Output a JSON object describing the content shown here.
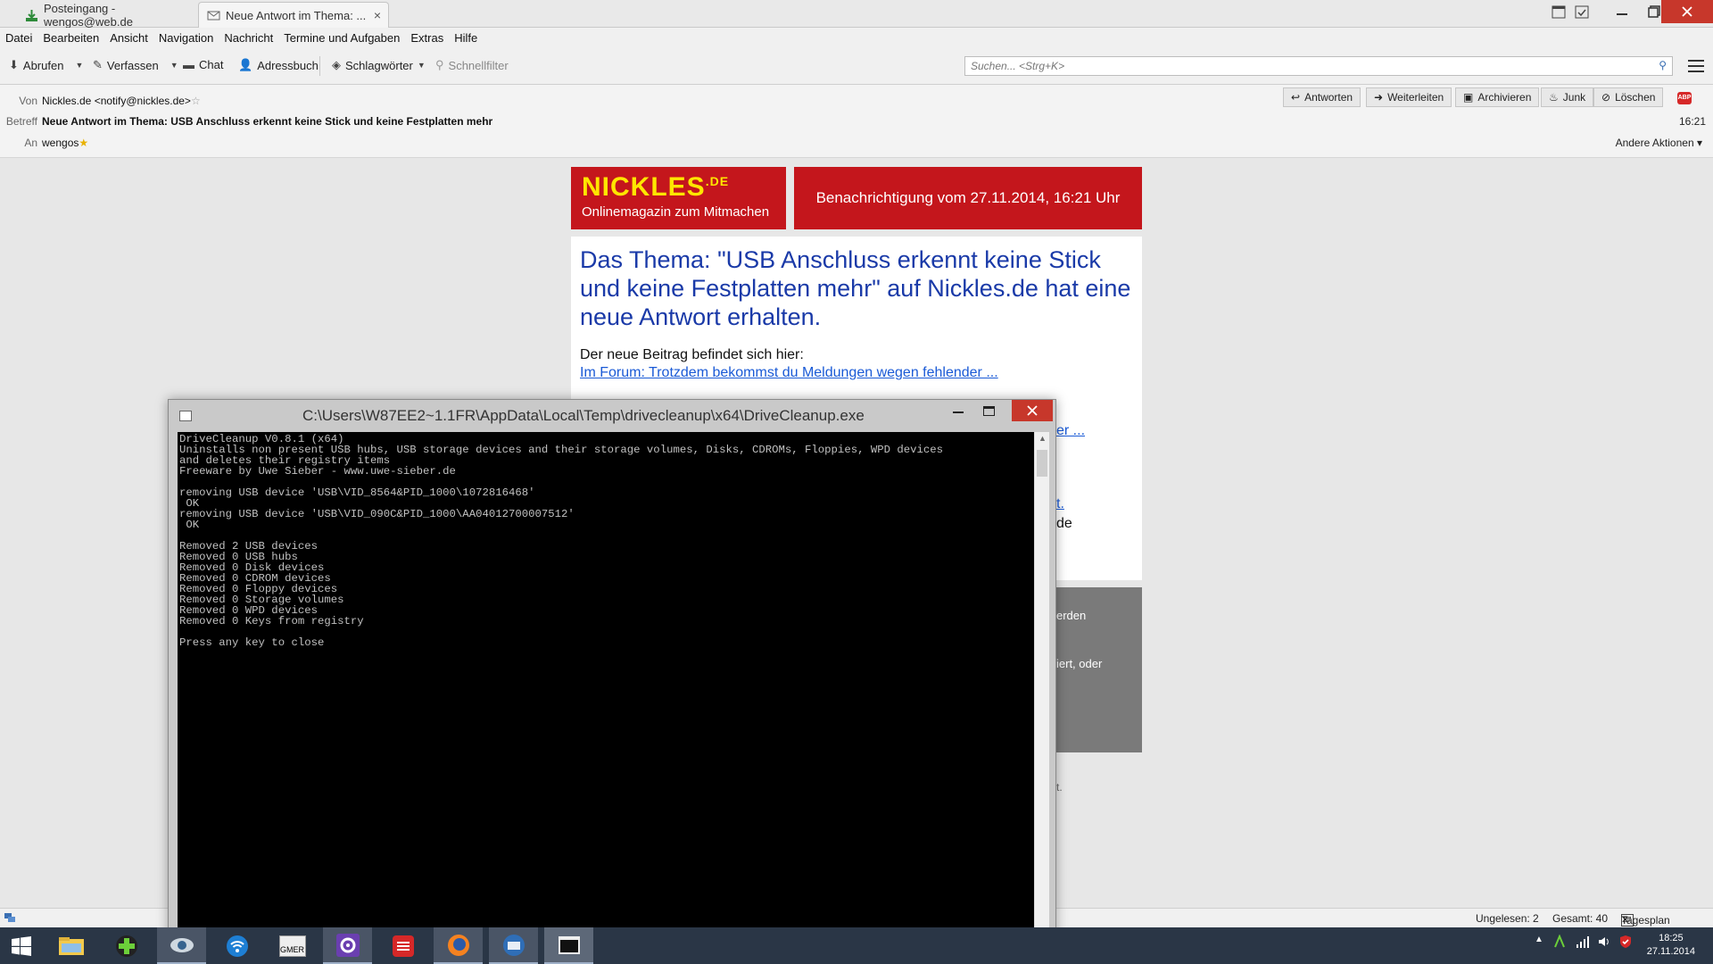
{
  "tabs": [
    {
      "label": "Posteingang - wengos@web.de"
    },
    {
      "label": "Neue Antwort im Thema: ...",
      "close": "×"
    }
  ],
  "menu": [
    "Datei",
    "Bearbeiten",
    "Ansicht",
    "Navigation",
    "Nachricht",
    "Termine und Aufgaben",
    "Extras",
    "Hilfe"
  ],
  "toolbar": {
    "abrufen": "Abrufen",
    "verfassen": "Verfassen",
    "chat": "Chat",
    "adressbuch": "Adressbuch",
    "schlagwoerter": "Schlagwörter",
    "schnellfilter": "Schnellfilter",
    "search_placeholder": "Suchen... <Strg+K>"
  },
  "header": {
    "von_label": "Von",
    "von": "Nickles.de <notify@nickles.de>",
    "betreff_label": "Betreff",
    "betreff": "Neue Antwort im Thema: USB Anschluss erkennt keine Stick und keine Festplatten mehr",
    "an_label": "An",
    "an": "wengos",
    "time": "16:21",
    "andere_aktionen": "Andere Aktionen",
    "buttons": [
      "Antworten",
      "Weiterleiten",
      "Archivieren",
      "Junk",
      "Löschen"
    ]
  },
  "email": {
    "logo_main": "NICKLES",
    "logo_sup": ".DE",
    "logo_sub": "Onlinemagazin zum Mitmachen",
    "banner": "Benachrichtigung vom 27.11.2014, 16:21 Uhr",
    "headline": "Das Thema: \"USB Anschluss erkennt keine Stick und keine Festplatten mehr\" auf Nickles.de hat eine neue Antwort erhalten.",
    "intro": "Der neue Beitrag befindet sich hier:",
    "link": "Im Forum: Trotzdem bekommst du Meldungen wegen fehlender ...",
    "frag_link2": "er ...",
    "frag_t": "t.",
    "frag_de": "de",
    "frag_erden": "erden",
    "frag_iert": "iert, oder",
    "frag_dot": "t."
  },
  "statusbar": {
    "ungelesen": "Ungelesen: 2",
    "gesamt": "Gesamt: 40",
    "tagesplan": "Tagesplan",
    "tagesplan_day": "27"
  },
  "console": {
    "title": "C:\\Users\\W87EE2~1.1FR\\AppData\\Local\\Temp\\drivecleanup\\x64\\DriveCleanup.exe",
    "lines": [
      "DriveCleanup V0.8.1 (x64)",
      "Uninstalls non present USB hubs, USB storage devices and their storage volumes, Disks, CDROMs, Floppies, WPD devices",
      "and deletes their registry items",
      "Freeware by Uwe Sieber - www.uwe-sieber.de",
      "",
      "removing USB device 'USB\\VID_8564&PID_1000\\1072816468'",
      " OK",
      "removing USB device 'USB\\VID_090C&PID_1000\\AA04012700007512'",
      " OK",
      "",
      "Removed 2 USB devices",
      "Removed 0 USB hubs",
      "Removed 0 Disk devices",
      "Removed 0 CDROM devices",
      "Removed 0 Floppy devices",
      "Removed 0 Storage volumes",
      "Removed 0 WPD devices",
      "Removed 0 Keys from registry",
      "",
      "Press any key to close"
    ]
  },
  "taskbar": {
    "clock_time": "18:25",
    "clock_date": "27.11.2014",
    "gmer": "GMER"
  },
  "colors": {
    "nickles_red": "#c4161c",
    "nickles_yellow": "#ffe600",
    "headline_blue": "#1a3aa8",
    "close_red": "#c7372b",
    "taskbar": "#2a3646"
  }
}
